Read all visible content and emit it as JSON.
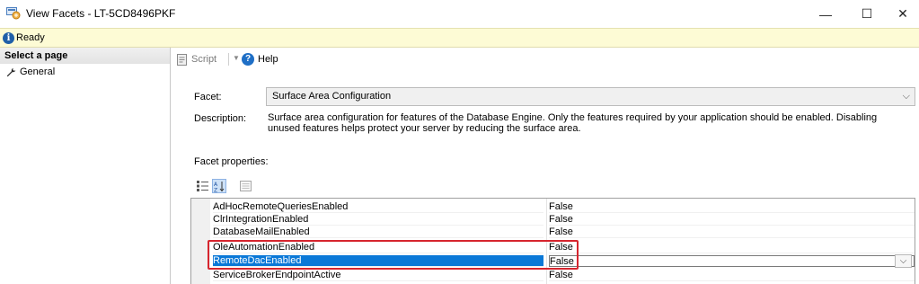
{
  "window": {
    "title": "View Facets - LT-5CD8496PKF",
    "minimize": "—",
    "maximize": "☐",
    "close": "✕"
  },
  "status": {
    "text": "Ready"
  },
  "left_pane": {
    "header": "Select a page",
    "items": [
      {
        "label": "General",
        "icon": "wrench-icon"
      }
    ]
  },
  "toolbar": {
    "script_label": "Script",
    "help_label": "Help"
  },
  "form": {
    "facet_label": "Facet:",
    "facet_value": "Surface Area Configuration",
    "description_label": "Description:",
    "description_value": "Surface area configuration for features of the Database Engine. Only the features required by your application should be enabled. Disabling unused features helps protect your server by reducing the surface area.",
    "facet_properties_label": "Facet properties:"
  },
  "property_grid": {
    "rows": [
      {
        "name": "AdHocRemoteQueriesEnabled",
        "value": "False"
      },
      {
        "name": "ClrIntegrationEnabled",
        "value": "False"
      },
      {
        "name": "DatabaseMailEnabled",
        "value": "False"
      },
      {
        "name": "OleAutomationEnabled",
        "value": "False"
      },
      {
        "name": "RemoteDacEnabled",
        "value": "False",
        "selected": true
      },
      {
        "name": "ServiceBrokerEndpointActive",
        "value": "False"
      }
    ]
  },
  "colors": {
    "status_bg": "#fdfbd5",
    "selection": "#0a78d7",
    "highlight_border": "#d6252e"
  }
}
